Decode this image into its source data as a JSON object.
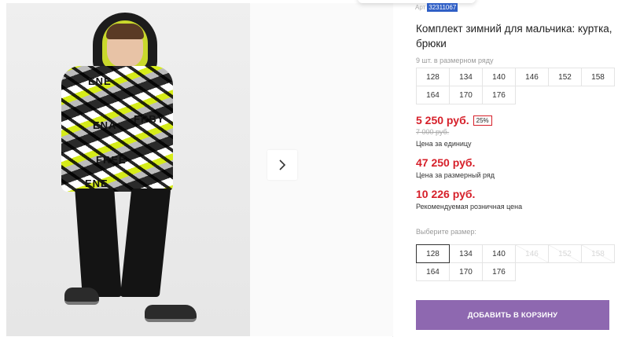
{
  "product": {
    "sku_label": "Арт",
    "sku": "32311067",
    "title": "Комплект зимний для мальчика: куртка, брюки",
    "pack_note": "9 шт. в размерном ряду",
    "pack_sizes": [
      "128",
      "134",
      "140",
      "146",
      "152",
      "158",
      "164",
      "170",
      "176"
    ],
    "price": "5 250 руб.",
    "discount": "25%",
    "old_price": "7 000 руб.",
    "unit_price_label": "Цена за единицу",
    "pack_price": "47 250 руб.",
    "pack_price_label": "Цена за размерный ряд",
    "retail_price": "10 226 руб.",
    "retail_price_label": "Рекомендуемая розничная цена",
    "choose_size_label": "Выберите размер:",
    "select_sizes": [
      {
        "label": "128",
        "state": "selected"
      },
      {
        "label": "134",
        "state": "available"
      },
      {
        "label": "140",
        "state": "available"
      },
      {
        "label": "146",
        "state": "unavailable"
      },
      {
        "label": "152",
        "state": "unavailable"
      },
      {
        "label": "158",
        "state": "unavailable"
      },
      {
        "label": "164",
        "state": "available"
      },
      {
        "label": "170",
        "state": "available"
      },
      {
        "label": "176",
        "state": "available"
      }
    ],
    "add_to_cart": "ДОБАВИТЬ В КОРЗИНУ"
  },
  "gallery": {
    "next_icon": "chevron-right-icon",
    "jacket_prints": [
      "ENE",
      "FRBY",
      "ENA",
      "FREE",
      "ENE"
    ]
  },
  "colors": {
    "price_red": "#d6202a",
    "button_purple": "#8e68b0",
    "sku_highlight": "#2f5fc6",
    "accent_yellow": "#c9d82c"
  }
}
